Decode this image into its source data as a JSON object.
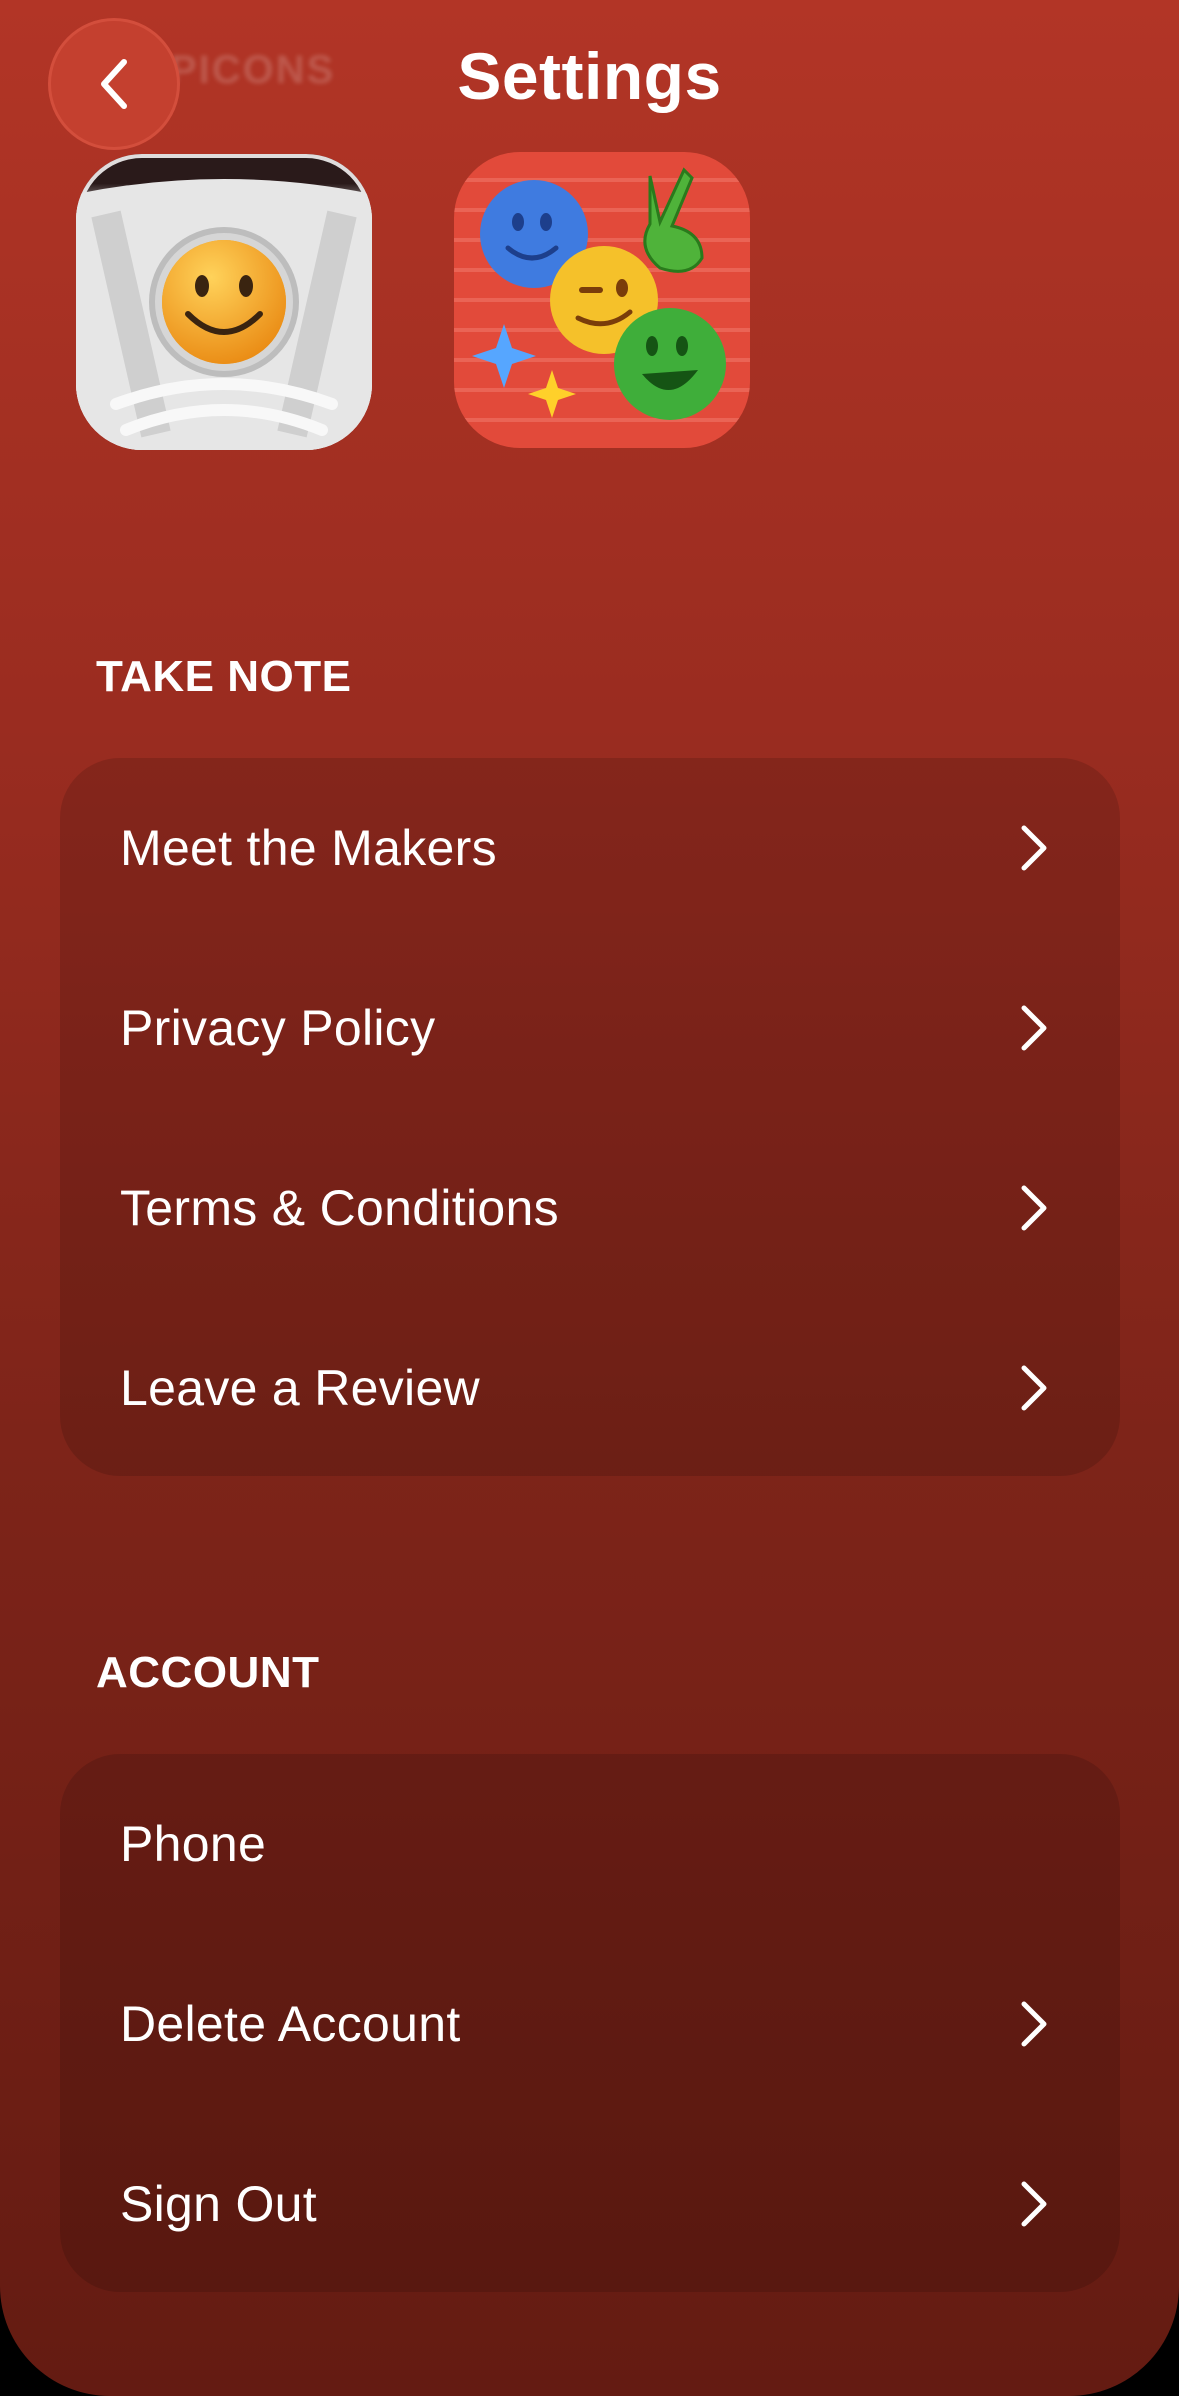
{
  "header": {
    "title": "Settings",
    "back_icon": "chevron-left-icon",
    "ghost_text": "PICONS"
  },
  "app_icons": [
    {
      "name": "smiley-sneaker-app-icon"
    },
    {
      "name": "emoji-faces-app-icon"
    }
  ],
  "sections": {
    "take_note": {
      "title": "TAKE NOTE",
      "items": [
        {
          "label": "Meet the Makers",
          "chevron": true
        },
        {
          "label": "Privacy Policy",
          "chevron": true
        },
        {
          "label": "Terms & Conditions",
          "chevron": true
        },
        {
          "label": "Leave a Review",
          "chevron": true
        }
      ]
    },
    "account": {
      "title": "ACCOUNT",
      "items": [
        {
          "label": "Phone",
          "chevron": false
        },
        {
          "label": "Delete Account",
          "chevron": true
        },
        {
          "label": "Sign Out",
          "chevron": true
        }
      ]
    }
  },
  "colors": {
    "background_top": "#b23526",
    "background_bottom": "#641b12",
    "text": "#ffffff"
  }
}
